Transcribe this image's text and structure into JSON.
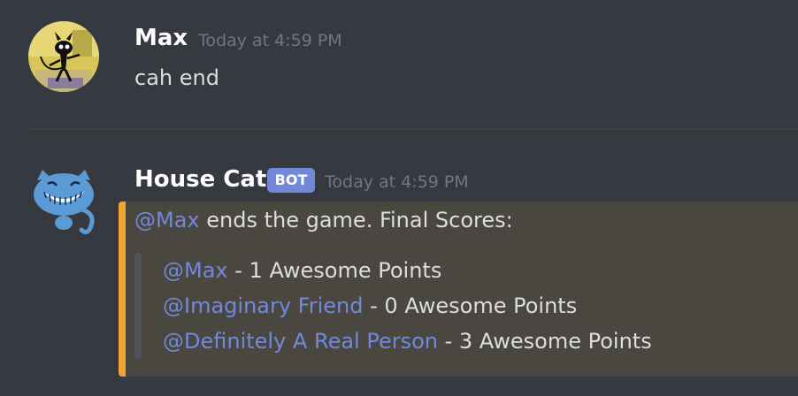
{
  "messages": [
    {
      "author": "Max",
      "timestamp": "Today at 4:59 PM",
      "text": "cah end"
    },
    {
      "author": "House Cat",
      "tag": "BOT",
      "timestamp": "Today at 4:59 PM",
      "intro_mention": "@Max",
      "intro_text": " ends the game. Final Scores:",
      "scores": [
        {
          "mention": "@Max",
          "text": " - 1 Awesome Points"
        },
        {
          "mention": "@Imaginary Friend",
          "text": " - 0 Awesome Points"
        },
        {
          "mention": "@Definitely A Real Person",
          "text": " - 3 Awesome Points"
        }
      ]
    }
  ],
  "colors": {
    "background": "#36393f",
    "mention": "#7289da",
    "highlight_bar": "#f1a532",
    "bot_tag": "#7289da"
  }
}
